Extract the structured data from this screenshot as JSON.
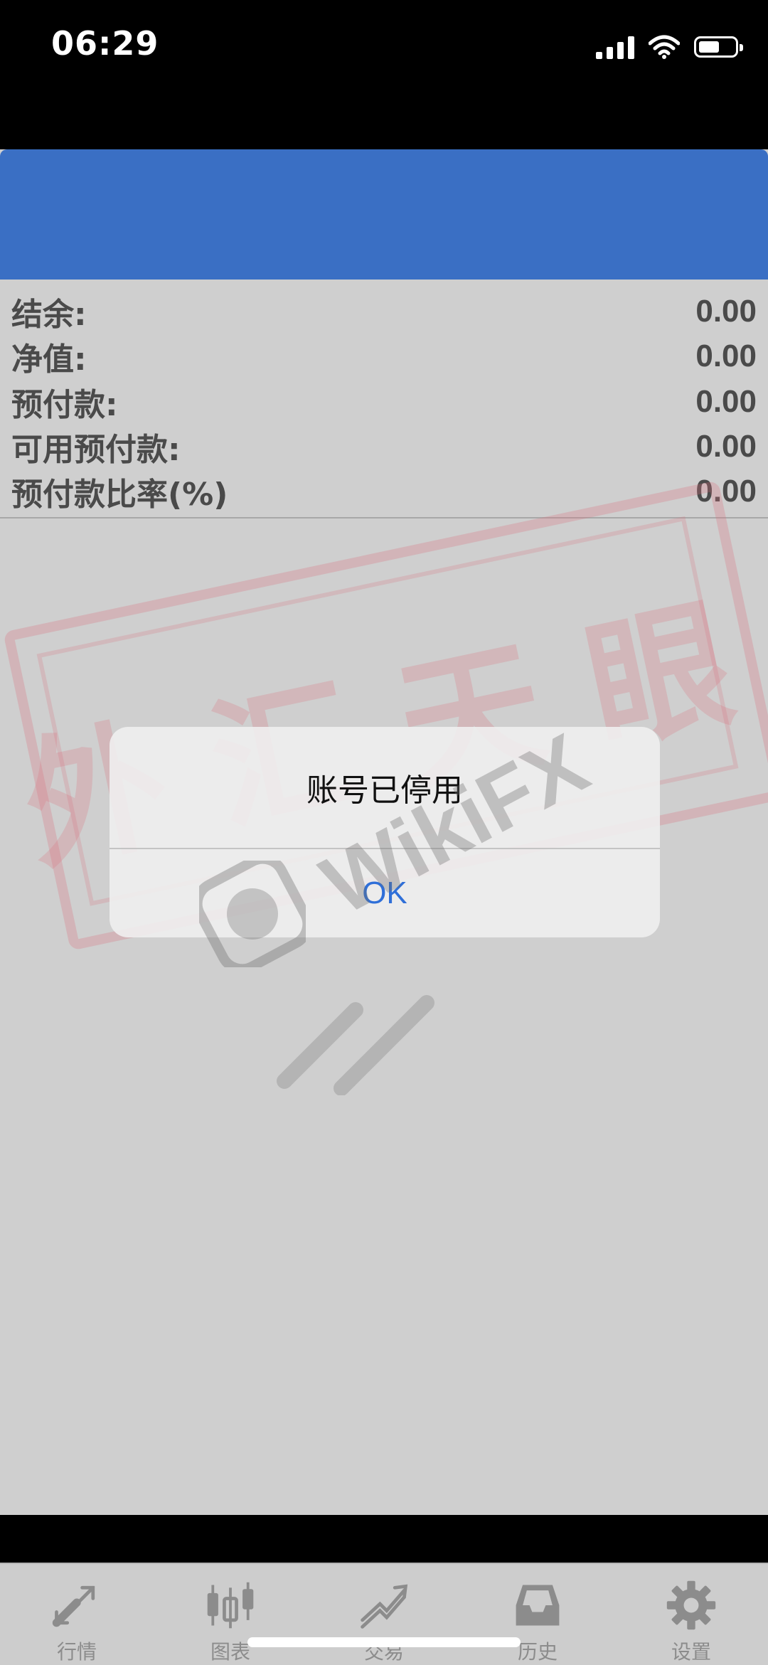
{
  "status_bar": {
    "time": "06:29"
  },
  "account": {
    "rows": [
      {
        "label": "结余:",
        "value": "0.00"
      },
      {
        "label": "净值:",
        "value": "0.00"
      },
      {
        "label": "预付款:",
        "value": "0.00"
      },
      {
        "label": "可用预付款:",
        "value": "0.00"
      },
      {
        "label": "预付款比率(%)",
        "value": "0.00"
      }
    ]
  },
  "watermark": {
    "stamp_text": [
      "外",
      "汇",
      "天",
      "眼"
    ],
    "brand": "WikiFX"
  },
  "dialog": {
    "message": "账号已停用",
    "ok_label": "OK"
  },
  "tabs": [
    {
      "label": "行情",
      "icon": "quotes-icon"
    },
    {
      "label": "图表",
      "icon": "chart-icon"
    },
    {
      "label": "交易",
      "icon": "trade-icon"
    },
    {
      "label": "历史",
      "icon": "history-icon"
    },
    {
      "label": "设置",
      "icon": "settings-icon"
    }
  ],
  "colors": {
    "header": "#3a6fc4",
    "link": "#2f6fd8",
    "tab_icon": "#8c8c8c"
  }
}
